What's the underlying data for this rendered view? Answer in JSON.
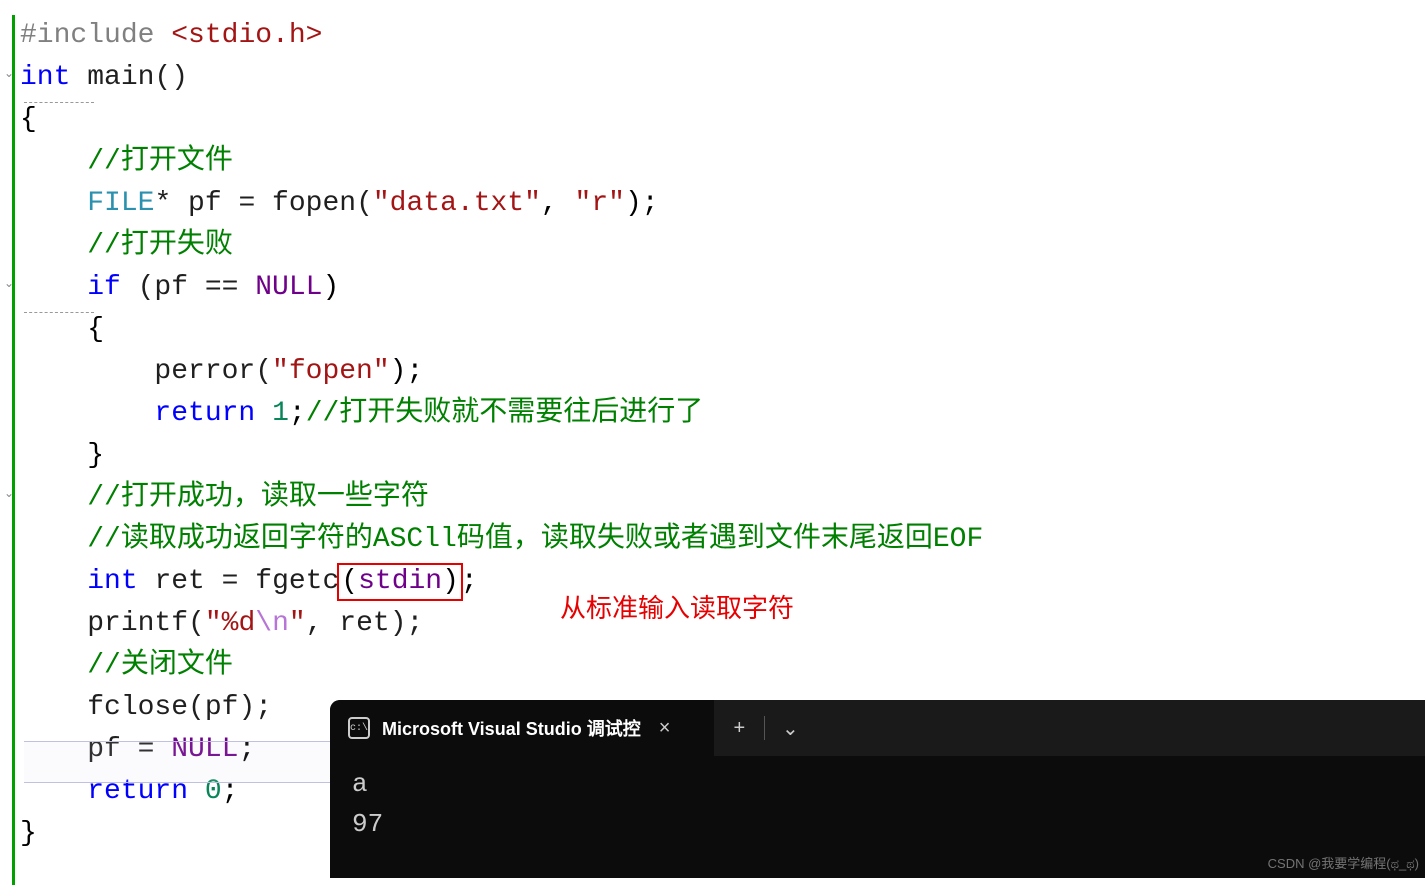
{
  "code": {
    "line1_include": "#include ",
    "line1_header": "<stdio.h>",
    "line2_int": "int",
    "line2_main": " main()",
    "line3": "{",
    "line4_comment": "//打开文件",
    "line5_type": "FILE",
    "line5_rest1": "* pf = fopen(",
    "line5_str1": "\"data.txt\"",
    "line5_comma": ", ",
    "line5_str2": "\"r\"",
    "line5_end": ");",
    "line6_comment": "//打开失败",
    "line7_if": "if",
    "line7_cond": " (pf == ",
    "line7_null": "NULL",
    "line7_close": ")",
    "line8": "{",
    "line9_perror": "perror(",
    "line9_str": "\"fopen\"",
    "line9_end": ");",
    "line10_return": "return",
    "line10_sp": " ",
    "line10_num": "1",
    "line10_semi": ";",
    "line10_comment": "//打开失败就不需要往后进行了",
    "line11": "}",
    "line12_comment": "//打开成功，读取一些字符",
    "line13_comment": "//读取成功返回字符的ASCll码值，读取失败或者遇到文件末尾返回EOF",
    "line14_int": "int",
    "line14_mid": " ret = fgetc",
    "line14_open": "(",
    "line14_stdin": "stdin",
    "line14_close": ")",
    "line14_semi": ";",
    "line15_printf": "printf(",
    "line15_str1": "\"%d",
    "line15_esc": "\\n",
    "line15_str2": "\"",
    "line15_rest": ", ret);",
    "line16_comment": "//关闭文件",
    "line17": "fclose(pf);",
    "line18_pf": "pf = ",
    "line18_null": "NULL",
    "line18_semi": ";",
    "line19_return": "return",
    "line19_sp": " ",
    "line19_num": "0",
    "line19_semi": ";",
    "line20": "}"
  },
  "annotation": {
    "stdin_note": "从标准输入读取字符"
  },
  "terminal": {
    "tab_title": "Microsoft Visual Studio 调试控",
    "output_line1": "a",
    "output_line2": "97"
  },
  "icons": {
    "cmd_glyph": "c:\\",
    "close": "×",
    "plus": "+",
    "chevron": "⌄"
  },
  "watermark": "CSDN @我要学编程(ಥ_ಥ)"
}
